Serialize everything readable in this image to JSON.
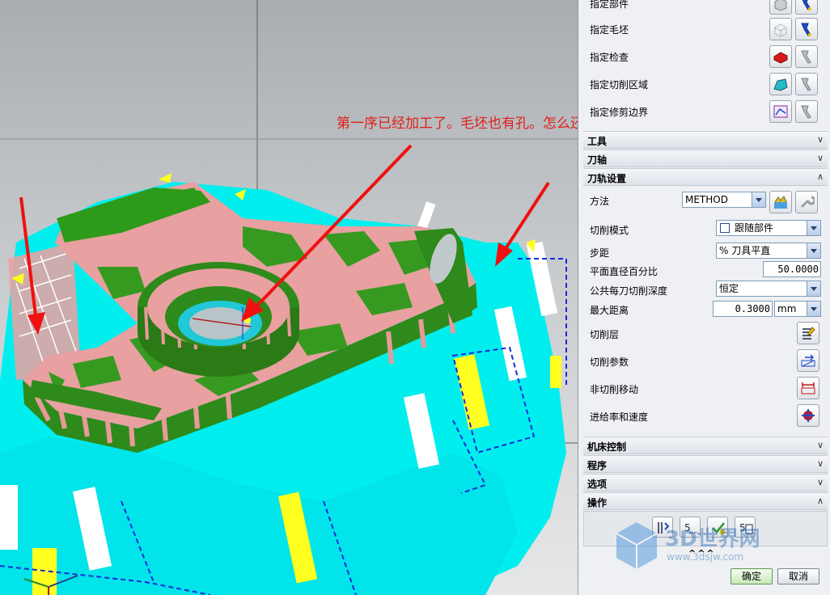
{
  "annotation": "第一序已经加工了。毛坯也有孔。怎么还加工",
  "geometry_rows": [
    {
      "label": "指定部件",
      "icon": "part-cube-icon"
    },
    {
      "label": "指定毛坯",
      "icon": "blank-wireframe-cube-icon"
    },
    {
      "label": "指定检查",
      "icon": "check-red-block-icon"
    },
    {
      "label": "指定切削区域",
      "icon": "cut-area-icon"
    },
    {
      "label": "指定修剪边界",
      "icon": "trim-boundary-icon"
    }
  ],
  "sections": {
    "tool": "工具",
    "axis": "刀轴",
    "path_settings": "刀轨设置",
    "machine_control": "机床控制",
    "program": "程序",
    "options": "选项",
    "actions": "操作"
  },
  "path_settings": {
    "method_label": "方法",
    "method_value": "METHOD",
    "cut_pattern_label": "切削模式",
    "cut_pattern_value": "跟随部件",
    "stepover_label": "步距",
    "stepover_value": "% 刀具平直",
    "percent_label": "平面直径百分比",
    "percent_value": "50.0000",
    "depth_label": "公共每刀切削深度",
    "depth_value": "恒定",
    "max_distance_label": "最大距离",
    "max_distance_value": "0.3000",
    "max_distance_unit": "mm",
    "cut_levels_label": "切削层",
    "cut_params_label": "切削参数",
    "non_cut_label": "非切削移动",
    "feeds_label": "进给率和速度"
  },
  "footer": {
    "collapse": "^^^",
    "ok": "确定",
    "cancel": "取消"
  },
  "watermark_text": "3D世界网",
  "watermark_url": "www.3dsjw.com",
  "colors": {
    "part_pink": "#e8a0a0",
    "cut_green": "#2e9a1a",
    "toolpath_cyan": "#00f0f0",
    "annotation_red": "#e0201a",
    "arrow_red": "#f01010"
  }
}
